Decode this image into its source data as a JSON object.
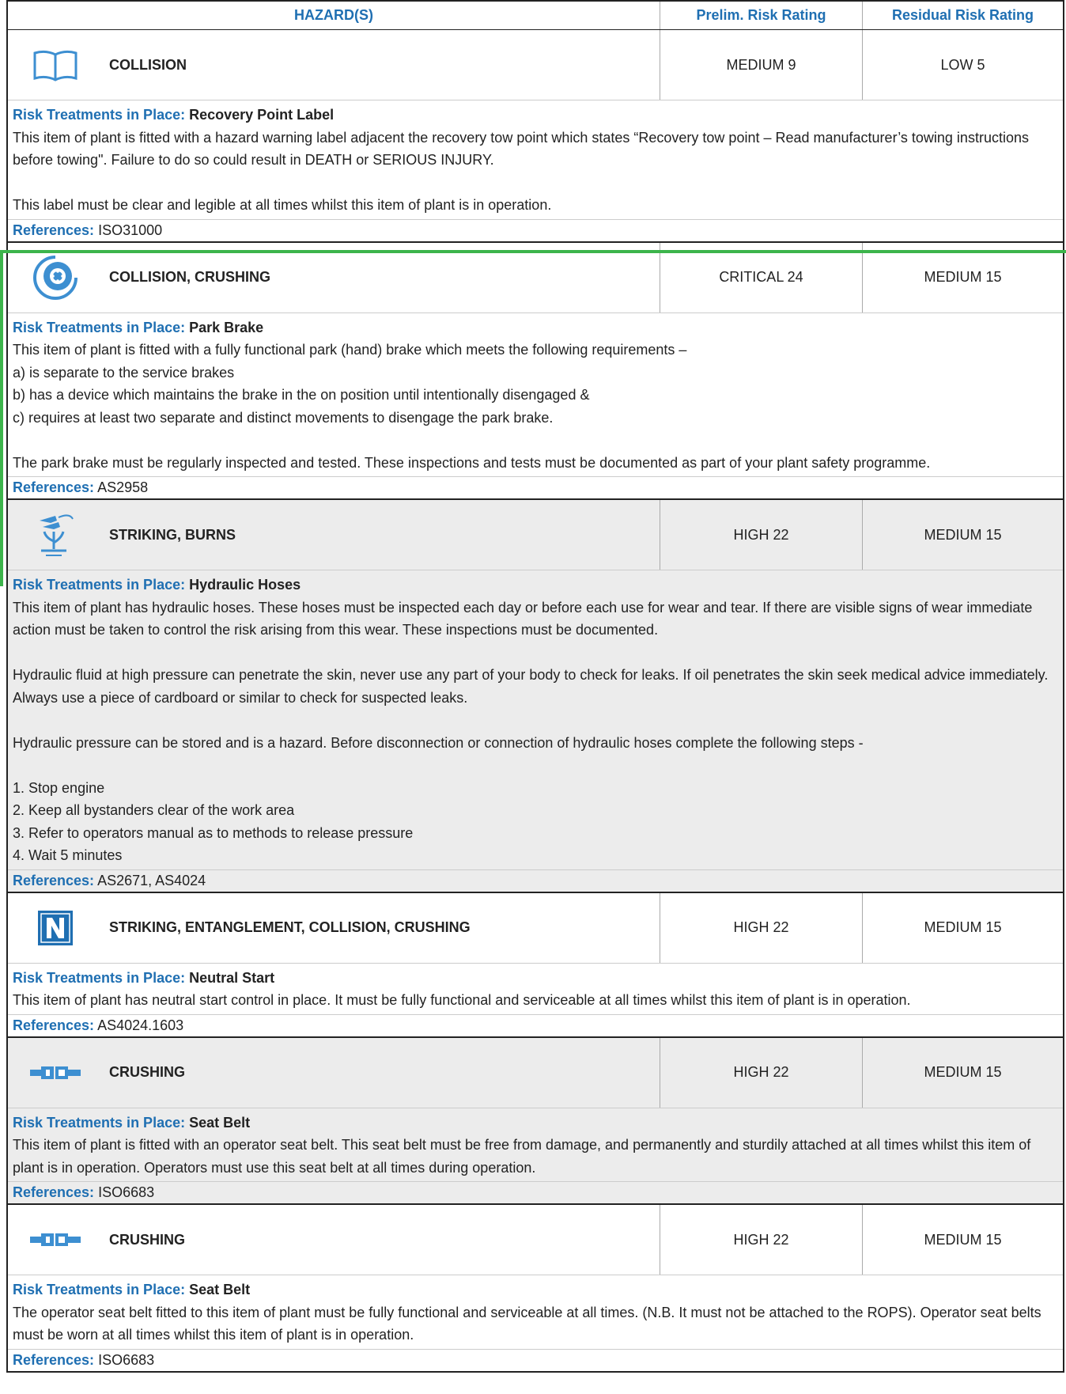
{
  "header": {
    "hazards": "HAZARD(S)",
    "prelim": "Prelim. Risk Rating",
    "residual": "Residual Risk Rating"
  },
  "labels": {
    "treatments": "Risk Treatments in Place:",
    "references": "References:"
  },
  "hazards": [
    {
      "icon": "book-icon",
      "title": "COLLISION",
      "prelim": "MEDIUM 9",
      "residual": "LOW 5",
      "treatment": "Recovery Point Label",
      "text": "This item of plant is fitted with a hazard warning label adjacent the recovery tow point which states “Recovery tow point – Read manufacturer’s towing instructions before towing\". Failure to do so could result in DEATH or SERIOUS INJURY.\n\nThis label must be clear and legible at all times whilst this item of plant is in operation.",
      "refs": "ISO31000"
    },
    {
      "icon": "brake-icon",
      "title": "COLLISION, CRUSHING",
      "prelim": "CRITICAL 24",
      "residual": "MEDIUM 15",
      "treatment": "Park Brake",
      "text": "This item of plant is fitted with a fully functional park (hand) brake which meets the following requirements –\na) is separate to the service brakes\nb) has a device which maintains the brake in the on position until intentionally disengaged &\nc) requires at least two separate and distinct movements to disengage the park brake.\n\nThe park brake must be regularly inspected and tested. These inspections and tests must be documented as part of your plant safety programme.",
      "refs": "AS2958"
    },
    {
      "icon": "hydraulic-hose-icon",
      "title": "STRIKING, BURNS",
      "prelim": "HIGH 22",
      "residual": "MEDIUM 15",
      "treatment": "Hydraulic Hoses",
      "text": "This item of plant has hydraulic hoses. These hoses must be inspected each day or before each use for wear and tear. If there are visible signs of wear immediate action must be taken to control the risk arising from this wear. These inspections must be documented.\n\nHydraulic fluid at high pressure can penetrate the skin, never use any part of your body to check for leaks. If oil penetrates the skin seek medical advice immediately. Always use a piece of cardboard or similar to check for suspected leaks.\n\nHydraulic pressure can be stored and is a hazard. Before disconnection or connection of hydraulic hoses complete the following steps -\n\n1. Stop engine\n2. Keep all bystanders clear of the work area\n3. Refer to operators manual as to methods to release pressure\n4. Wait 5 minutes",
      "refs": "AS2671, AS4024"
    },
    {
      "icon": "neutral-n-icon",
      "title": "STRIKING, ENTANGLEMENT, COLLISION, CRUSHING",
      "prelim": "HIGH 22",
      "residual": "MEDIUM 15",
      "treatment": "Neutral Start",
      "text": "This item of plant has neutral start control in place. It must be fully functional and serviceable at all times whilst this item of plant is in operation.",
      "refs": "AS4024.1603"
    },
    {
      "icon": "seat-belt-icon",
      "title": "CRUSHING",
      "prelim": "HIGH 22",
      "residual": "MEDIUM 15",
      "treatment": "Seat Belt",
      "text": "This item of plant is fitted with an operator seat belt. This seat belt must be free from damage, and permanently and sturdily attached at all times whilst this item of plant is in operation. Operators must use this seat belt at all times during operation.",
      "refs": "ISO6683"
    },
    {
      "icon": "seat-belt-icon",
      "title": "CRUSHING",
      "prelim": "HIGH 22",
      "residual": "MEDIUM 15",
      "treatment": "Seat Belt",
      "text": "The operator seat belt fitted to this item of plant must be fully functional and serviceable at all times. (N.B. It must not be attached to the ROPS). Operator seat belts must be worn at all times whilst this item of plant is in operation.",
      "refs": "ISO6683"
    }
  ],
  "colors": {
    "accent": "#1f6fb2",
    "icon": "#3d8fd1",
    "selection": "#3cb44b",
    "grey_row": "#ececec"
  }
}
